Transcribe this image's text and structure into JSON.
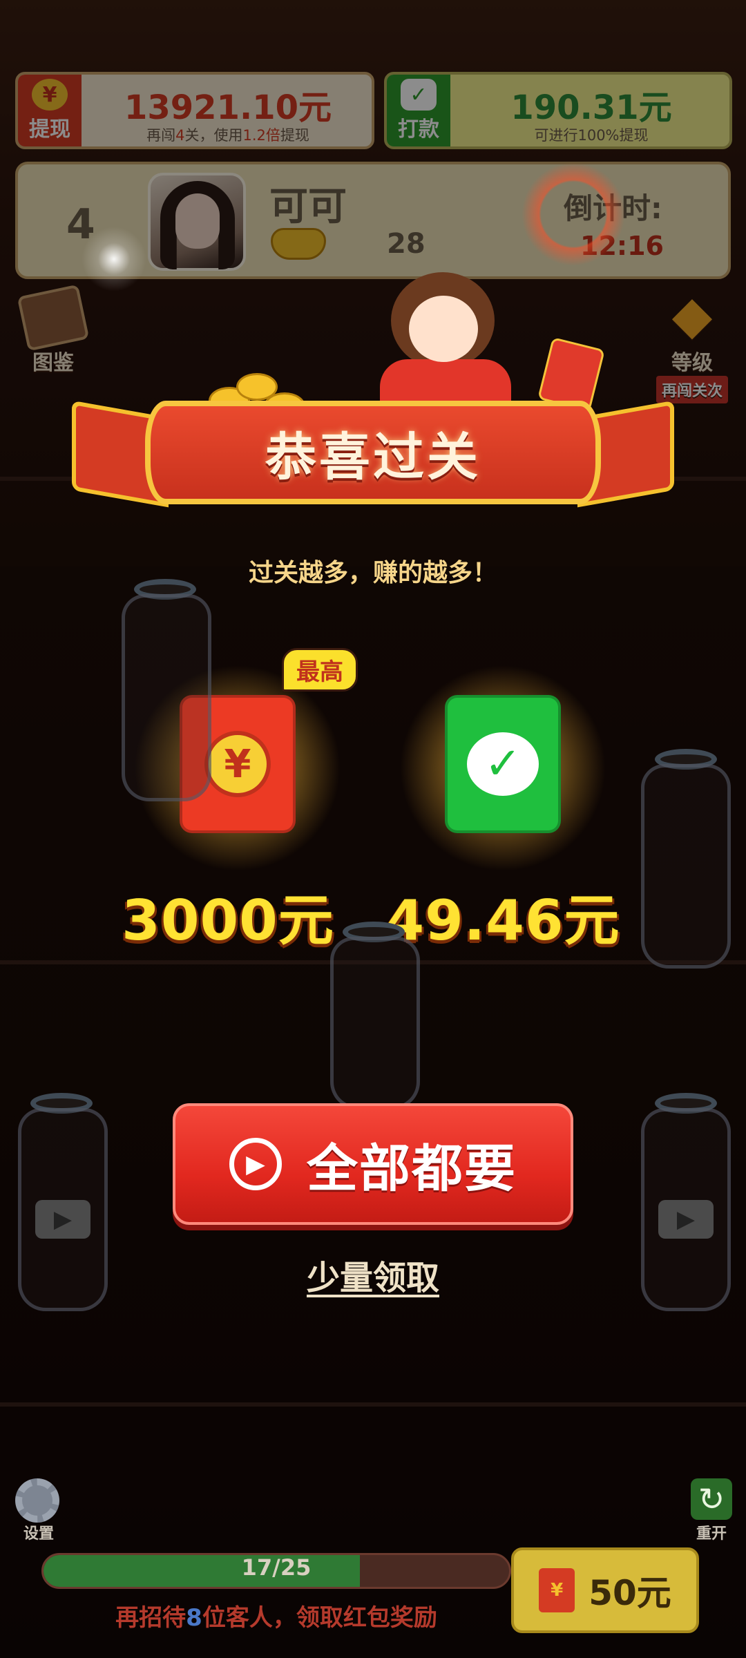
{
  "top_bar": {
    "withdraw": {
      "icon": "yuan-icon",
      "label": "提现",
      "amount": "13921.10元",
      "hint_prefix": "再闯",
      "hint_levels": "4",
      "hint_mid": "关，使用",
      "hint_multiplier": "1.2倍",
      "hint_suffix": "提现"
    },
    "payout": {
      "icon": "wechat-icon",
      "label": "打款",
      "amount": "190.31元",
      "hint": "可进行100%提现"
    }
  },
  "player": {
    "rank": "4",
    "name": "可可",
    "ingot_count": "28",
    "countdown_label": "倒计时:",
    "countdown_value": "12:16"
  },
  "side_buttons": {
    "catalog_label": "图鉴",
    "level_label": "等级",
    "level_tag": "再闯关次"
  },
  "dialog": {
    "title": "恭喜过关",
    "subtitle": "过关越多，赚的越多！",
    "rewards": [
      {
        "type": "red-envelope",
        "icon": "yuan-icon",
        "badge": "最高",
        "amount": "3000元"
      },
      {
        "type": "wechat-cash",
        "icon": "wechat-check-icon",
        "amount": "49.46元"
      }
    ],
    "primary_button": "全部都要",
    "secondary_link": "少量领取"
  },
  "bottom": {
    "settings_label": "设置",
    "restart_label": "重开",
    "progress": {
      "current": 17,
      "total": 25,
      "text": "17/25"
    },
    "prompt_prefix": "再招待",
    "prompt_count": "8",
    "prompt_suffix": "位客人，领取红包奖励",
    "reward_button": "50元",
    "reward_icon_glyph": "¥"
  },
  "colors": {
    "cta_red": "#e2281f",
    "amount_yellow": "#ffe233",
    "progress_green": "#2f7a34"
  }
}
